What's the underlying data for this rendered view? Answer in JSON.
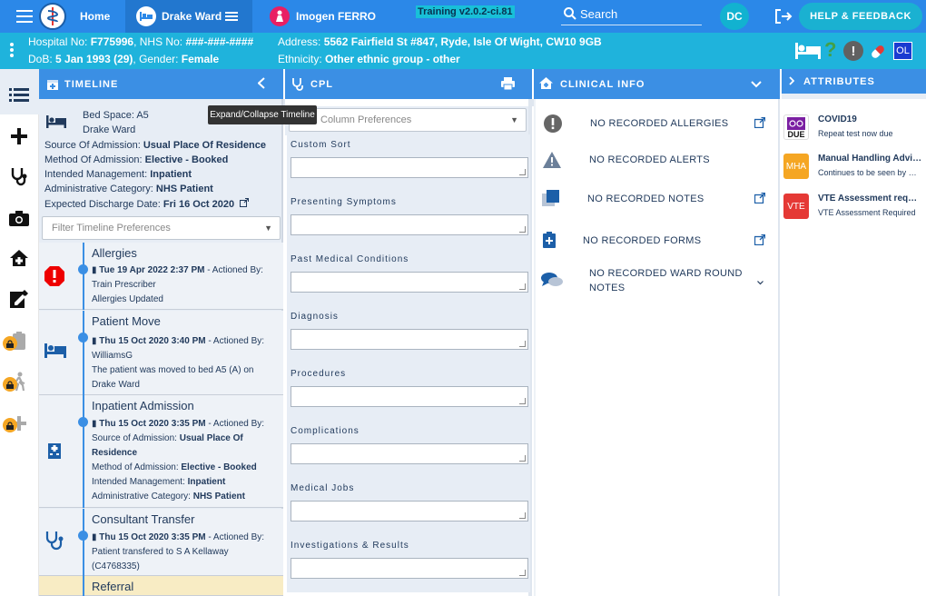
{
  "topbar": {
    "home_label": "Home",
    "ward_label": "Drake Ward",
    "patient_name": "Imogen FERRO",
    "version": "Training v2.0.2-ci.81",
    "search_placeholder": "Search",
    "user_initials": "DC",
    "help_label": "HELP & FEEDBACK"
  },
  "patient_banner": {
    "hospital_no_label": "Hospital No:",
    "hospital_no": "F775996",
    "nhs_no_label": ", NHS No:",
    "nhs_no": "###-###-####",
    "address_label": "Address:",
    "address": "5562 Fairfield St #847, Ryde, Isle Of Wight, CW10 9GB",
    "dob_label": "DoB:",
    "dob": "5 Jan 1993 (29)",
    "gender_label": ", Gender:",
    "gender": "Female",
    "ethnicity_label": "Ethnicity:",
    "ethnicity": "Other ethnic group - other",
    "ol_badge": "OL"
  },
  "columns": {
    "timeline": "TIMELINE",
    "cpl": "CPL",
    "clinical": "CLINICAL INFO",
    "attributes": "ATTRIBUTES"
  },
  "tooltip": "Expand/Collapse Timeline",
  "bed": {
    "bed_space": "Bed Space: A5",
    "ward": "Drake Ward",
    "source_label": "Source Of Admission:",
    "source": "Usual Place Of Residence",
    "method_label": "Method Of Admission:",
    "method": "Elective - Booked",
    "intended_label": "Intended Management:",
    "intended": "Inpatient",
    "admin_label": "Administrative Category:",
    "admin": "NHS Patient",
    "discharge_label": "Expected Discharge Date:",
    "discharge": "Fri 16 Oct 2020"
  },
  "timeline_filter_placeholder": "Filter Timeline Preferences",
  "timeline_items": [
    {
      "title": "Allergies",
      "date": "Tue 19 Apr 2022 2:37 PM",
      "actioned": " - Actioned By:",
      "l1": "Train Prescriber",
      "l2": "Allergies Updated"
    },
    {
      "title": "Patient Move",
      "date": "Thu 15 Oct 2020 3:40 PM",
      "actioned": " - Actioned By:",
      "l1": "WilliamsG",
      "l2": "The patient was moved to bed A5 (A) on",
      "l3": "Drake Ward"
    },
    {
      "title": "Inpatient Admission",
      "date": "Thu 15 Oct 2020 3:35 PM",
      "actioned": " - Actioned By:",
      "src_label": "Source of Admission:",
      "src": "Usual Place Of",
      "src2": "Residence",
      "meth_label": "Method of Admission:",
      "meth": "Elective - Booked",
      "int_label": "Intended Management:",
      "int": "Inpatient",
      "adm_label": "Administrative Category:",
      "adm": "NHS Patient"
    },
    {
      "title": "Consultant Transfer",
      "date": "Thu 15 Oct 2020 3:35 PM",
      "actioned": " - Actioned By:",
      "l1": "Patient transfered to S A Kellaway",
      "l2": "(C4768335)"
    },
    {
      "title": "Referral"
    }
  ],
  "cpl": {
    "column_prefs_placeholder": "Column Preferences",
    "sections": [
      "Custom Sort",
      "Presenting Symptoms",
      "Past Medical Conditions",
      "Diagnosis",
      "Procedures",
      "Complications",
      "Medical Jobs",
      "Investigations & Results"
    ]
  },
  "clinical": {
    "allergies": "NO RECORDED ALLERGIES",
    "alerts": "NO RECORDED ALERTS",
    "notes": "NO RECORDED NOTES",
    "forms": "NO RECORDED FORMS",
    "ward_round_1": "NO RECORDED WARD ROUND",
    "ward_round_2": "NOTES"
  },
  "attributes": [
    {
      "badge": "DUE",
      "title": "COVID19",
      "sub": "Repeat test now due",
      "color": "#7b1fa2"
    },
    {
      "badge": "MHA",
      "title": "Manual Handling Advice",
      "sub": "Continues to be seen by MHA team",
      "color": "#f5a623"
    },
    {
      "badge": "VTE",
      "title": "VTE Assessment required",
      "sub": "VTE Assessment Required",
      "color": "#e53935"
    }
  ]
}
